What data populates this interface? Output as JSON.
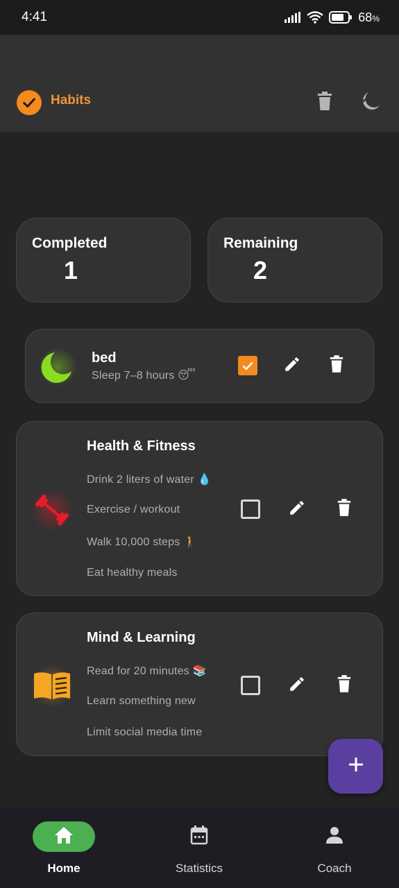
{
  "status_bar": {
    "time": "4:41",
    "battery_percent": "68",
    "battery_unit": "%"
  },
  "app_bar": {
    "title": "Habits",
    "logo_icon": "check-circle-icon",
    "actions": [
      "trash-icon",
      "moon-icon"
    ]
  },
  "summary": {
    "completed_label": "Completed",
    "completed_value": "1",
    "remaining_label": "Remaining",
    "remaining_value": "2"
  },
  "habits": [
    {
      "title": "bed",
      "items": [
        "Sleep 7–8 hours 😴"
      ],
      "icon": "moon-icon",
      "icon_color": "#8bdc1f",
      "checked": true
    },
    {
      "title": "Health & Fitness",
      "items": [
        "Drink 2 liters of water 💧",
        "Exercise / workout",
        "Walk 10,000 steps 🚶",
        "Eat healthy meals"
      ],
      "icon": "dumbbell-icon",
      "icon_color": "#e81c2a",
      "checked": false
    },
    {
      "title": "Mind & Learning",
      "items": [
        "Read for 20 minutes 📚",
        "Learn something new",
        "Limit social media time"
      ],
      "icon": "book-icon",
      "icon_color": "#f5a623",
      "checked": false
    }
  ],
  "fab": {
    "icon": "plus-icon"
  },
  "nav": {
    "home": "Home",
    "statistics": "Statistics",
    "coach": "Coach"
  },
  "colors": {
    "accent": "#f58a1f",
    "fab": "#5b3fa0",
    "nav_active": "#4caf50"
  }
}
